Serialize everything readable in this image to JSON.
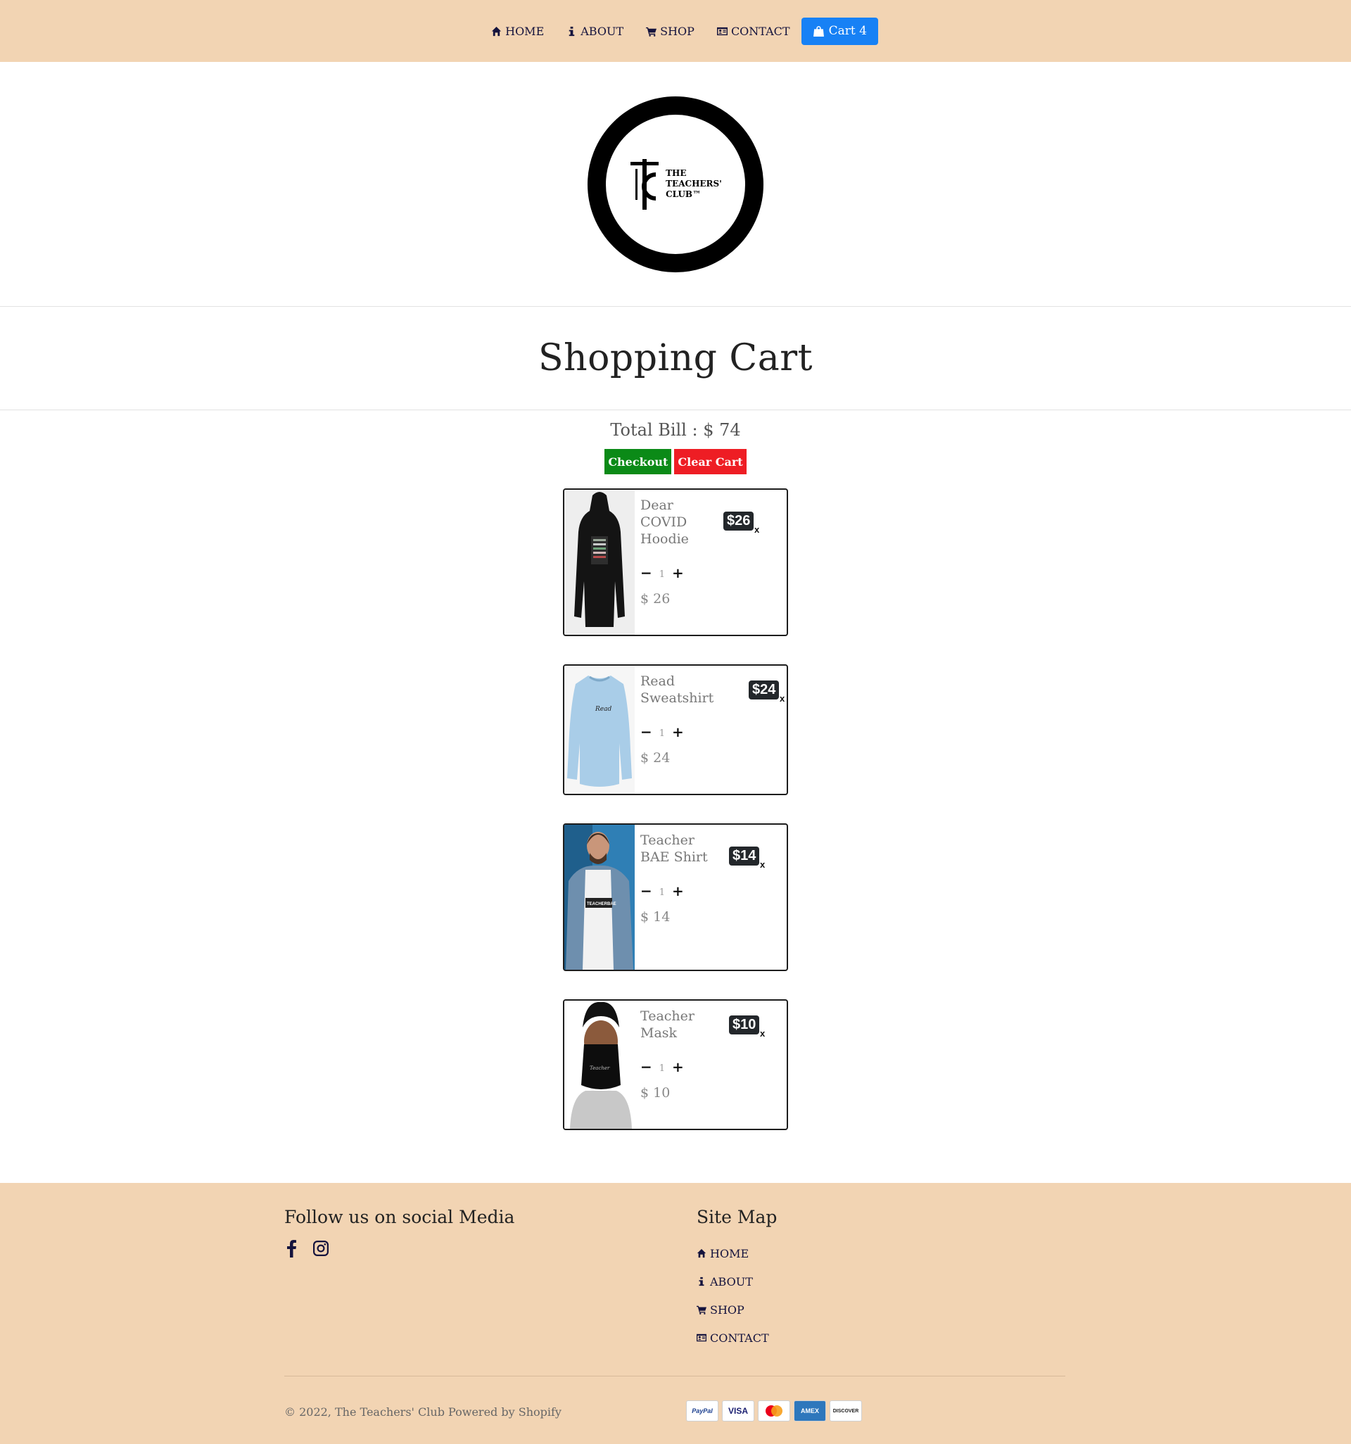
{
  "nav": {
    "items": [
      {
        "label": "HOME",
        "icon": "home-icon"
      },
      {
        "label": "ABOUT",
        "icon": "info-icon"
      },
      {
        "label": "SHOP",
        "icon": "shopping-cart-icon"
      },
      {
        "label": "CONTACT",
        "icon": "id-card-icon"
      }
    ],
    "cart_label": "Cart 4"
  },
  "logo": {
    "line1": "THE",
    "line2": "TEACHERS'",
    "line3": "CLUB™"
  },
  "page_title": "Shopping Cart",
  "total_bill": "Total Bill : $ 74",
  "actions": {
    "checkout": "Checkout",
    "clear": "Clear Cart"
  },
  "cart_items": [
    {
      "name": "Dear COVID Hoodie",
      "badge": "$26",
      "qty": "1",
      "price": "$ 26",
      "remove": "x"
    },
    {
      "name": "Read Sweatshirt",
      "badge": "$24",
      "qty": "1",
      "price": "$ 24",
      "remove": "x"
    },
    {
      "name": "Teacher BAE Shirt",
      "badge": "$14",
      "qty": "1",
      "price": "$ 14",
      "remove": "x"
    },
    {
      "name": "Teacher Mask",
      "badge": "$10",
      "qty": "1",
      "price": "$ 10",
      "remove": "x"
    }
  ],
  "footer": {
    "social_heading": "Follow us on social Media",
    "sitemap_heading": "Site Map",
    "sitemap": [
      "HOME",
      "ABOUT",
      "SHOP",
      "CONTACT"
    ],
    "copyright": "© 2022, The Teachers' Club Powered by Shopify",
    "payments": [
      "PayPal",
      "VISA",
      "Mastercard",
      "AMEX",
      "DISCOVER"
    ]
  },
  "colors": {
    "nav_bg": "#f2d4b3",
    "cart_button": "#1781f5",
    "checkout": "#0b8a17",
    "clear_cart": "#ee1d24",
    "badge": "#23272b",
    "link": "#15133d"
  }
}
